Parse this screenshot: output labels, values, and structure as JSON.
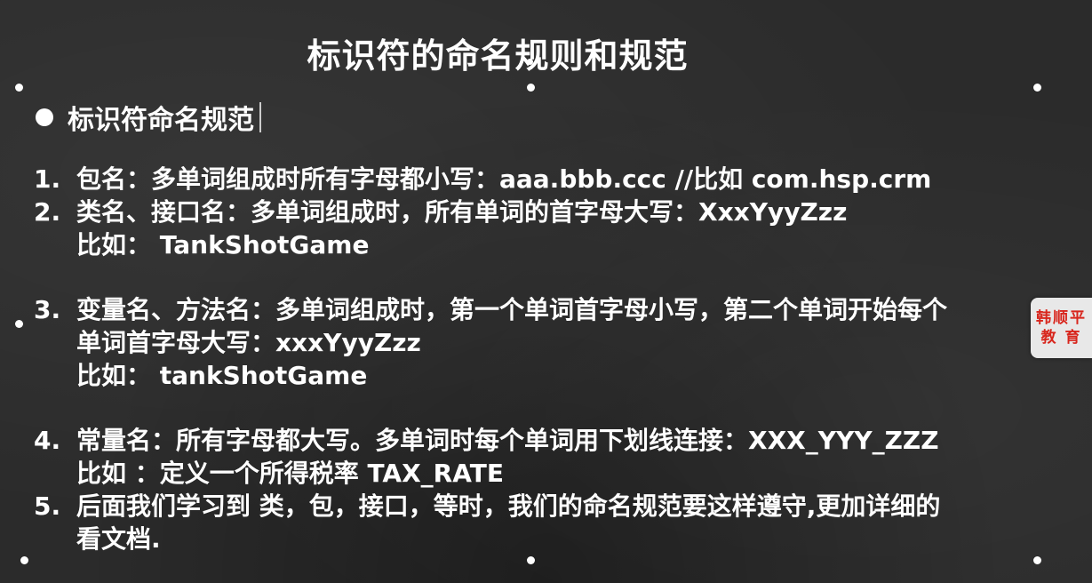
{
  "slide": {
    "title": "标识符的命名规则和规范",
    "section_heading": "标识符命名规范"
  },
  "items": [
    {
      "num": "1.",
      "lines": [
        "包名：多单词组成时所有字母都小写：aaa.bbb.ccc //比如 com.hsp.crm"
      ]
    },
    {
      "num": "2.",
      "lines": [
        "类名、接口名：多单词组成时，所有单词的首字母大写：XxxYyyZzz",
        "比如： TankShotGame"
      ]
    },
    {
      "num": "3.",
      "lines": [
        "变量名、方法名：多单词组成时，第一个单词首字母小写，第二个单词开始每个",
        "单词首字母大写：xxxYyyZzz",
        "比如： tankShotGame"
      ]
    },
    {
      "num": "4.",
      "lines": [
        "常量名：所有字母都大写。多单词时每个单词用下划线连接：XXX_YYY_ZZZ",
        "比如 ：定义一个所得税率 TAX_RATE"
      ]
    },
    {
      "num": "5.",
      "lines": [
        "后面我们学习到 类，包，接口，等时，我们的命名规范要这样遵守,更加详细的",
        "看文档."
      ]
    }
  ],
  "logo": {
    "line1": "韩顺平",
    "line2": "教 育",
    "color": "#d8261d"
  }
}
